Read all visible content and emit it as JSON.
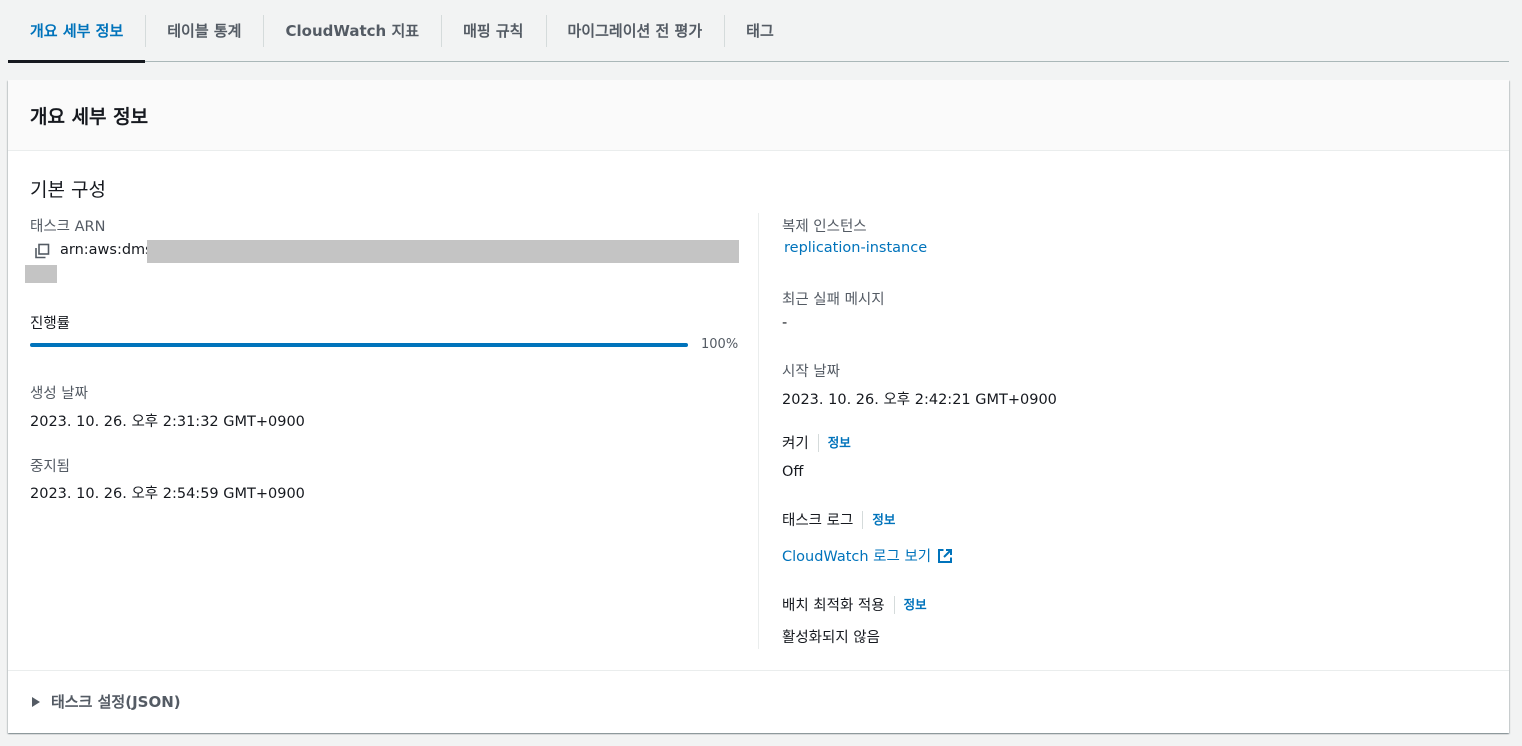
{
  "tabs": [
    {
      "label": "개요 세부 정보",
      "active": true
    },
    {
      "label": "테이블 통계"
    },
    {
      "label": "CloudWatch 지표"
    },
    {
      "label": "매핑 규칙"
    },
    {
      "label": "마이그레이션 전 평가"
    },
    {
      "label": "태그"
    }
  ],
  "panel": {
    "title": "개요 세부 정보",
    "section_title": "기본 구성"
  },
  "left": {
    "arn_label": "태스크 ARN",
    "arn_value": "arn:aws:dms",
    "progress_label": "진행률",
    "progress_value": 1.0,
    "progress_text": "100%",
    "created_label": "생성 날짜",
    "created_value": "2023. 10. 26. 오후  2:31:32 GMT+0900",
    "stopped_label": "중지됨",
    "stopped_value": "2023. 10. 26. 오후   2:54:59 GMT+0900"
  },
  "right": {
    "instance_label": "복제 인스턴스",
    "instance_value": "replication-instance",
    "fail_msg_label": "최근 실패 메시지",
    "fail_msg_value": "-",
    "start_label": "시작 날짜",
    "start_value": "2023. 10. 26. 오후  2:42:21 GMT+0900",
    "enabled_label": "켜기",
    "enabled_info": "정보",
    "enabled_value": "Off",
    "tasklog_label": "태스크 로그",
    "tasklog_info": "정보",
    "tasklog_link": "CloudWatch 로그 보기",
    "batch_label": "배치 최적화 적용",
    "batch_info": "정보",
    "batch_value": "활성화되지 않음"
  },
  "footer": {
    "expand_label": "태스크 설정(JSON)"
  },
  "colors": {
    "accent": "#0073bb",
    "text": "#16191f",
    "muted": "#545b64"
  }
}
